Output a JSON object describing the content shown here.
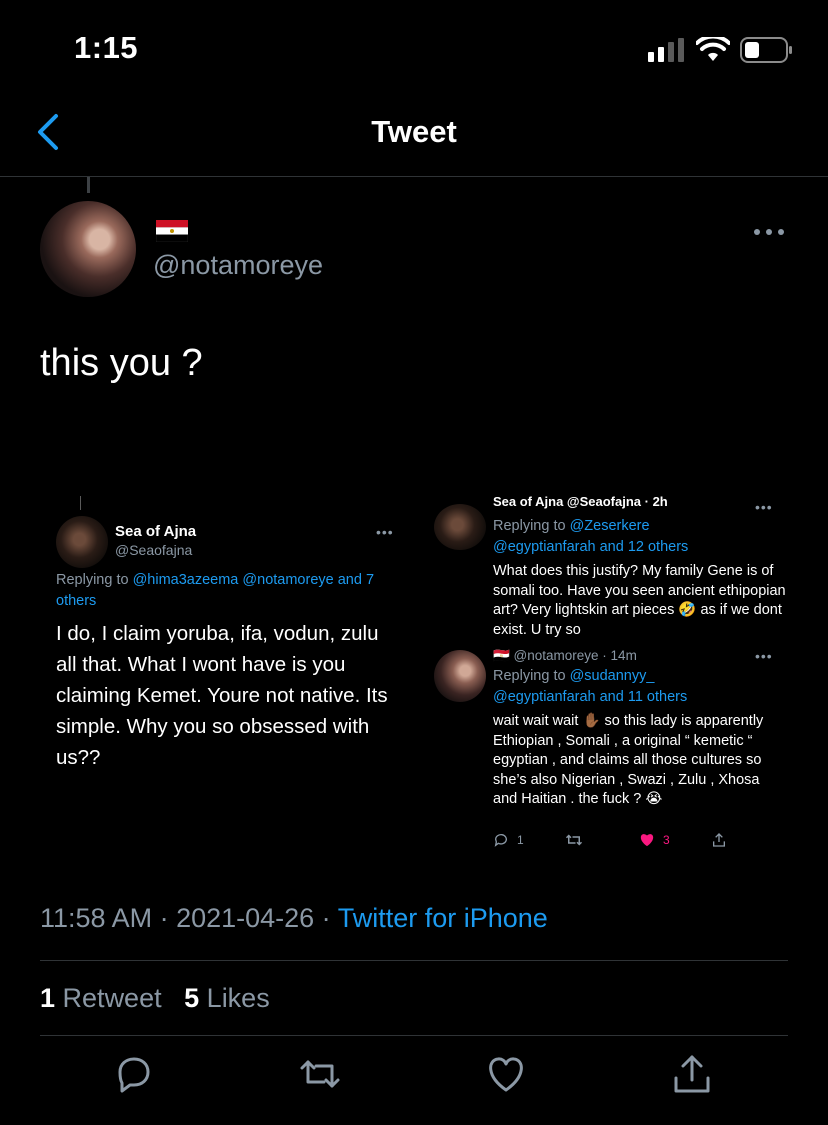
{
  "status_bar": {
    "time": "1:15"
  },
  "nav": {
    "title": "Tweet"
  },
  "tweet": {
    "display_name_emoji": "🇪🇬",
    "handle": "@notamoreye",
    "text": "this you ?",
    "timestamp": "11:58 AM · 2021-04-26 · ",
    "source": "Twitter for iPhone",
    "retweet_count": "1",
    "retweet_label": "Retweet",
    "like_count": "5",
    "like_label": "Likes"
  },
  "screenshot_left": {
    "name": "Sea of Ajna",
    "handle": "@Seaofajna",
    "replying_prefix": "Replying to ",
    "replying_to": "@hima3azeema @notamoreye and 7 others",
    "body": "I do, I claim yoruba, ifa, vodun, zulu all that. What I wont have is you claiming Kemet. Youre not native. Its simple. Why you so obsessed with us??",
    "more": "•••"
  },
  "screenshot_right": {
    "top_header": "Sea of Ajna @Seaofajna · 2h",
    "top_replying_prefix": "Replying to ",
    "top_replying_to_1": "@Zeserkere",
    "top_replying_to_2": "@egyptianfarah and 12 others",
    "top_body": "What does this justify? My family Gene is of somali too. Have you seen ancient ethipopian art? Very lightskin art pieces 🤣 as if we dont exist. U try so",
    "bottom_header": "🇪🇬 @notamoreye · 14m",
    "bottom_replying_prefix": "Replying to ",
    "bottom_replying_to_1": "@sudannyy_",
    "bottom_replying_to_2": "@egyptianfarah and 11 others",
    "bottom_body": "wait wait wait ✋🏾 so this lady is apparently Ethiopian , Somali , a original “ kemetic “ egyptian , and claims all those cultures so she’s also Nigerian , Swazi , Zulu , Xhosa and Haitian . the fuck ? 😭",
    "reply_count": "1",
    "like_count": "3",
    "more": "•••"
  },
  "colors": {
    "accent": "#1d9bf0",
    "secondary_text": "#8b98a5",
    "background": "#000000",
    "divider": "#2f3336",
    "like_red": "#f91880"
  },
  "icons": [
    "back-chevron-icon",
    "more-icon",
    "reply-icon",
    "retweet-icon",
    "like-icon",
    "share-icon",
    "signal-icon",
    "wifi-icon",
    "battery-icon"
  ]
}
